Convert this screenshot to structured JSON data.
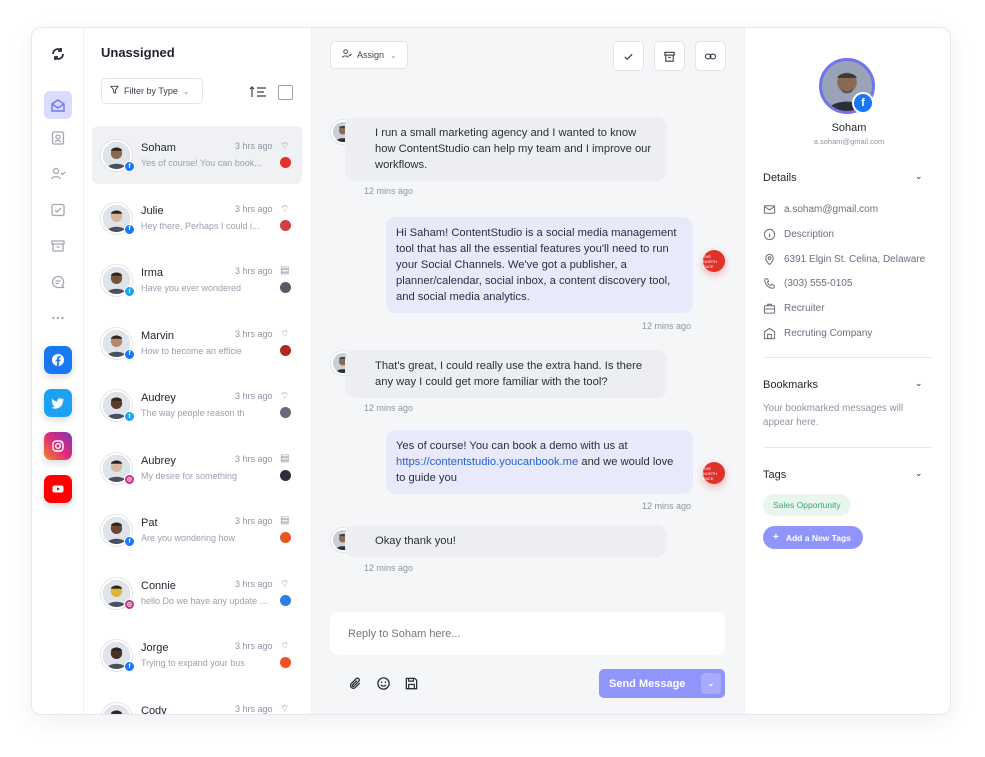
{
  "rail": {
    "items": [
      {
        "name": "refresh-icon"
      },
      {
        "name": "inbox-icon"
      },
      {
        "name": "contacts-icon"
      },
      {
        "name": "assigned-icon"
      },
      {
        "name": "done-icon"
      },
      {
        "name": "archive-icon"
      },
      {
        "name": "comments-icon"
      },
      {
        "name": "more-icon"
      }
    ],
    "socials": [
      {
        "name": "facebook",
        "glyph": "f",
        "color": "#1877f2"
      },
      {
        "name": "twitter",
        "glyph": "t",
        "color": "#1da1f2"
      },
      {
        "name": "instagram",
        "glyph": "◎",
        "color": "#dd2a7b"
      },
      {
        "name": "youtube",
        "glyph": "▶",
        "color": "#ff0000"
      }
    ]
  },
  "list": {
    "title": "Unassigned",
    "filter_label": "Filter by Type",
    "conversations": [
      {
        "name": "Soham",
        "time": "3 hrs ago",
        "preview": "Yes of course! You can book...",
        "network": "fb",
        "brand_color": "#e0312a",
        "active": true,
        "skin": "#8a6a52"
      },
      {
        "name": "Julie",
        "time": "3 hrs ago",
        "preview": "Hey there, Perhaps I could i...",
        "network": "fb",
        "brand_color": "#d13f3f",
        "active": false,
        "skin": "#d9b49a"
      },
      {
        "name": "Irma",
        "time": "3 hrs ago",
        "preview": "Have you ever wondered",
        "network": "tw",
        "brand_color": "#555a66",
        "active": false,
        "skin": "#7a5236"
      },
      {
        "name": "Marvin",
        "time": "3 hrs ago",
        "preview": "How to become an efficie",
        "network": "fb",
        "brand_color": "#b0281f",
        "active": false,
        "skin": "#b58868"
      },
      {
        "name": "Audrey",
        "time": "3 hrs ago",
        "preview": "The way people reason th",
        "network": "tw",
        "brand_color": "#666b78",
        "active": false,
        "skin": "#5c3b28"
      },
      {
        "name": "Aubrey",
        "time": "3 hrs ago",
        "preview": "My desire for something",
        "network": "ig",
        "brand_color": "#2b2f3a",
        "active": false,
        "skin": "#d7b8a0"
      },
      {
        "name": "Pat",
        "time": "3 hrs ago",
        "preview": "Are you wondering how",
        "network": "fb",
        "brand_color": "#e8551f",
        "active": false,
        "skin": "#6b4630"
      },
      {
        "name": "Connie",
        "time": "3 hrs ago",
        "preview": "hello Do we have any update h...",
        "network": "ig",
        "brand_color": "#2f7de1",
        "active": false,
        "skin": "#e3b23c"
      },
      {
        "name": "Jorge",
        "time": "3 hrs ago",
        "preview": "Trying to expand your bus",
        "network": "fb",
        "brand_color": "#f25022",
        "active": false,
        "skin": "#4a3022"
      },
      {
        "name": "Cody",
        "time": "3 hrs ago",
        "preview": "",
        "network": "fb",
        "brand_color": "#888",
        "active": false,
        "skin": "#6a5545"
      }
    ]
  },
  "toolbar": {
    "assign_label": "Assign"
  },
  "chat": {
    "messages": [
      {
        "dir": "in",
        "text": "I run a small marketing agency and I wanted to know how ContentStudio can help my team and I improve our workflows.",
        "time": "12 mins ago"
      },
      {
        "dir": "out",
        "text": "Hi Saham! ContentStudio is a social media management tool that has all the essential features you'll need to run your Social Channels. We've got a publisher, a planner/calendar, social inbox, a content discovery tool, and social media analytics.",
        "time": "12 mins ago"
      },
      {
        "dir": "in",
        "text": "That's great, I could really use the extra hand. Is there any way I could get more familiar with the tool?",
        "time": "12 mins ago"
      },
      {
        "dir": "out",
        "text_before": "Yes of course! You can book a demo with us at ",
        "link": "https://contentstudio.youcanbook.me",
        "text_after": " and we would love to guide you",
        "time": "12 mins ago"
      },
      {
        "dir": "in",
        "text": "Okay thank you!",
        "time": "12 mins ago"
      }
    ],
    "brand_label": "THE NORTH FACE",
    "reply_placeholder": "Reply to Soham here...",
    "send_label": "Send Message"
  },
  "profile": {
    "name": "Soham",
    "email": "a.soham@gmail.com",
    "details_title": "Details",
    "details": [
      {
        "icon": "mail-icon",
        "text": "a.soham@gmail.com"
      },
      {
        "icon": "info-icon",
        "text": "Description"
      },
      {
        "icon": "location-icon",
        "text": "6391 Elgin St. Celina, Delaware"
      },
      {
        "icon": "phone-icon",
        "text": "(303) 555-0105"
      },
      {
        "icon": "briefcase-icon",
        "text": "Recruiter"
      },
      {
        "icon": "building-icon",
        "text": "Recruting Company"
      }
    ],
    "bookmarks_title": "Bookmarks",
    "bookmarks_text": "Your bookmarked messages will appear here.",
    "tags_title": "Tags",
    "tag": "Sales Opportunity",
    "add_tag_label": "Add a New Tags"
  }
}
